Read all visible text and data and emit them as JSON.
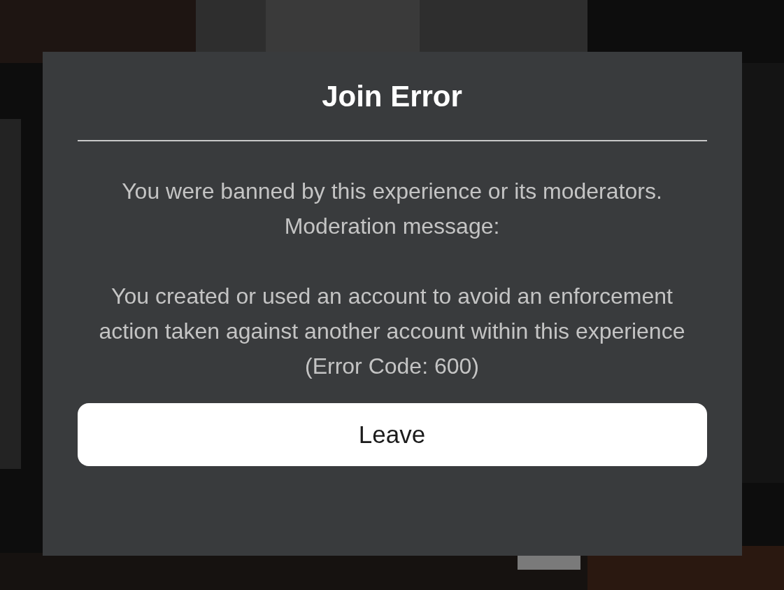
{
  "dialog": {
    "title": "Join Error",
    "message": "You were banned by this experience or its moderators. Moderation message:",
    "moderation_message": "You created or used an account to avoid an enforcement action taken against another account within this experience",
    "error_code": "(Error Code: 600)",
    "button": "Leave"
  }
}
